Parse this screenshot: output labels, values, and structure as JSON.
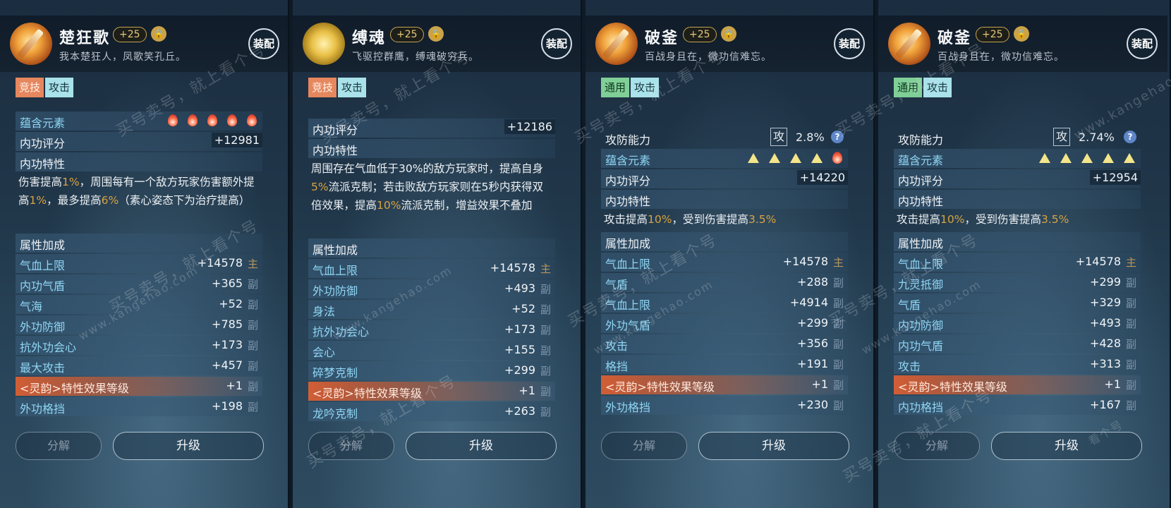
{
  "panels": [
    {
      "name": "楚狂歌",
      "level": "+25",
      "motto": "我本楚狂人，凤歌笑孔丘。",
      "equip": "装配",
      "tags": [
        {
          "text": "竞技",
          "kind": "arena"
        },
        {
          "text": "攻击",
          "kind": "attack"
        }
      ],
      "element_label": "蕴含元素",
      "elements": [
        "fire",
        "fire",
        "fire",
        "fire",
        "fire"
      ],
      "score_label": "内功评分",
      "score": "+12981",
      "trait_label": "内功特性",
      "trait_parts": [
        "伤害提高",
        "1%",
        "，周围每有一个敌方玩家伤害额外提高",
        "1%",
        "，最多提高",
        "6%",
        "（素心姿态下为治疗提高）"
      ],
      "attr_label": "属性加成",
      "attrs": [
        {
          "label": "气血上限",
          "value": "+14578",
          "mark": "主"
        },
        {
          "label": "内功气盾",
          "value": "+365",
          "mark": "副"
        },
        {
          "label": "气海",
          "value": "+52",
          "mark": "副"
        },
        {
          "label": "外功防御",
          "value": "+785",
          "mark": "副"
        },
        {
          "label": "抗外功会心",
          "value": "+173",
          "mark": "副"
        },
        {
          "label": "最大攻击",
          "value": "+457",
          "mark": "副"
        },
        {
          "label": "<灵韵>特性效果等级",
          "value": "+1",
          "mark": "副"
        },
        {
          "label": "外功格挡",
          "value": "+198",
          "mark": "副"
        }
      ],
      "decompose": "分解",
      "upgrade": "升级"
    },
    {
      "name": "缚魂",
      "level": "+25",
      "motto": "飞驱控群鹰，缚魂破穷兵。",
      "equip": "装配",
      "tags": [
        {
          "text": "竞技",
          "kind": "arena"
        },
        {
          "text": "攻击",
          "kind": "attack"
        }
      ],
      "score_label": "内功评分",
      "score": "+12186",
      "trait_label": "内功特性",
      "trait_parts": [
        "周围存在气血低于30%的敌方玩家时，提高自身",
        "5%",
        "流派克制；若击败敌方玩家则在5秒内获得双倍效果，提高",
        "10%",
        "流派克制，增益效果不叠加"
      ],
      "attr_label": "属性加成",
      "attrs": [
        {
          "label": "气血上限",
          "value": "+14578",
          "mark": "主"
        },
        {
          "label": "外功防御",
          "value": "+493",
          "mark": "副"
        },
        {
          "label": "身法",
          "value": "+52",
          "mark": "副"
        },
        {
          "label": "抗外功会心",
          "value": "+173",
          "mark": "副"
        },
        {
          "label": "会心",
          "value": "+155",
          "mark": "副"
        },
        {
          "label": "碎梦克制",
          "value": "+299",
          "mark": "副"
        },
        {
          "label": "<灵韵>特性效果等级",
          "value": "+1",
          "mark": "副"
        },
        {
          "label": "龙吟克制",
          "value": "+263",
          "mark": "副"
        }
      ],
      "decompose": "分解",
      "upgrade": "升级"
    },
    {
      "name": "破釜",
      "level": "+25",
      "motto": "百战身且在，微功信难忘。",
      "equip": "装配",
      "tags": [
        {
          "text": "通用",
          "kind": "general"
        },
        {
          "text": "攻击",
          "kind": "attack"
        }
      ],
      "atk_label": "攻防能力",
      "atk_box": "攻",
      "atk_pct": "2.8%",
      "element_label": "蕴含元素",
      "elements": [
        "light",
        "light",
        "light",
        "light",
        "fire"
      ],
      "score_label": "内功评分",
      "score": "+14220",
      "trait_label": "内功特性",
      "trait_parts": [
        "攻击提高",
        "10%",
        "，受到伤害提高",
        "3.5%",
        ""
      ],
      "attr_label": "属性加成",
      "attrs": [
        {
          "label": "气血上限",
          "value": "+14578",
          "mark": "主"
        },
        {
          "label": "气盾",
          "value": "+288",
          "mark": "副"
        },
        {
          "label": "气血上限",
          "value": "+4914",
          "mark": "副"
        },
        {
          "label": "外功气盾",
          "value": "+299",
          "mark": "副"
        },
        {
          "label": "攻击",
          "value": "+356",
          "mark": "副"
        },
        {
          "label": "格挡",
          "value": "+191",
          "mark": "副"
        },
        {
          "label": "<灵韵>特性效果等级",
          "value": "+1",
          "mark": "副"
        },
        {
          "label": "外功格挡",
          "value": "+230",
          "mark": "副"
        }
      ],
      "decompose": "分解",
      "upgrade": "升级"
    },
    {
      "name": "破釜",
      "level": "+25",
      "motto": "百战身且在，微功信难忘。",
      "equip": "装配",
      "tags": [
        {
          "text": "通用",
          "kind": "general"
        },
        {
          "text": "攻击",
          "kind": "attack"
        }
      ],
      "atk_label": "攻防能力",
      "atk_box": "攻",
      "atk_pct": "2.74%",
      "element_label": "蕴含元素",
      "elements": [
        "light",
        "light",
        "light",
        "light",
        "light"
      ],
      "score_label": "内功评分",
      "score": "+12954",
      "trait_label": "内功特性",
      "trait_parts": [
        "攻击提高",
        "10%",
        "，受到伤害提高",
        "3.5%",
        ""
      ],
      "attr_label": "属性加成",
      "attrs": [
        {
          "label": "气血上限",
          "value": "+14578",
          "mark": "主"
        },
        {
          "label": "九灵抵御",
          "value": "+299",
          "mark": "副"
        },
        {
          "label": "气盾",
          "value": "+329",
          "mark": "副"
        },
        {
          "label": "内功防御",
          "value": "+493",
          "mark": "副"
        },
        {
          "label": "内功气盾",
          "value": "+428",
          "mark": "副"
        },
        {
          "label": "攻击",
          "value": "+313",
          "mark": "副"
        },
        {
          "label": "<灵韵>特性效果等级",
          "value": "+1",
          "mark": "副"
        },
        {
          "label": "内功格挡",
          "value": "+167",
          "mark": "副"
        }
      ],
      "decompose": "分解",
      "upgrade": "升级"
    }
  ],
  "watermark": {
    "text": "买号卖号，就上看个号",
    "url": "www.kangehao.com",
    "brand": "看个号"
  }
}
